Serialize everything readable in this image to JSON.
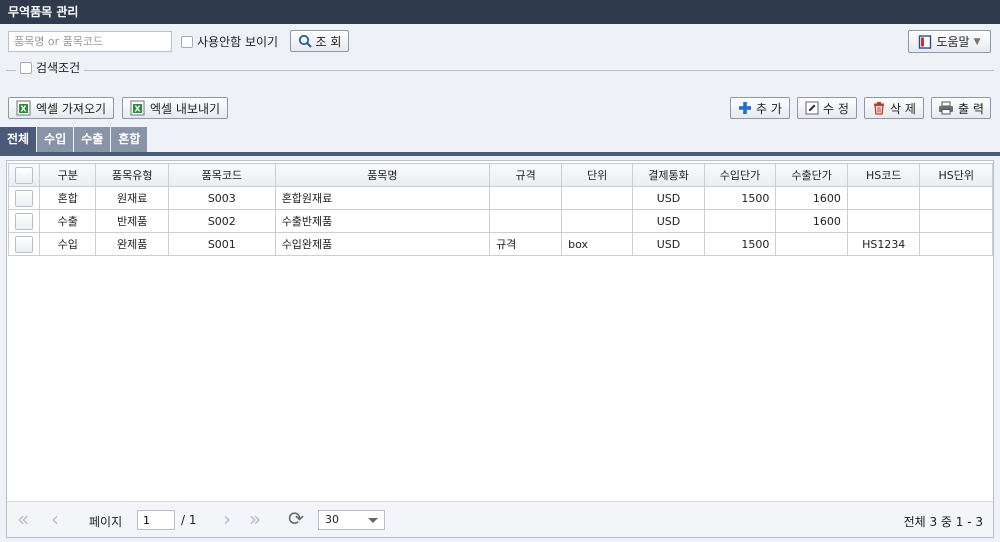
{
  "window": {
    "title": "무역품목 관리"
  },
  "search": {
    "placeholder": "품목명 or 품목코드",
    "value": ""
  },
  "show_unused": {
    "label": "사용안함 보이기",
    "checked": false
  },
  "buttons": {
    "search": "조 회",
    "help": "도움말",
    "excel_import": "엑셀 가져오기",
    "excel_export": "엑셀 내보내기",
    "add": "추 가",
    "edit": "수 정",
    "delete": "삭 제",
    "print": "출 력"
  },
  "search_conditions": {
    "label": "검색조건",
    "checked": false
  },
  "tabs": [
    {
      "label": "전체",
      "active": true
    },
    {
      "label": "수입",
      "active": false
    },
    {
      "label": "수출",
      "active": false
    },
    {
      "label": "혼합",
      "active": false
    }
  ],
  "grid": {
    "columns": [
      "구분",
      "품목유형",
      "품목코드",
      "품목명",
      "규격",
      "단위",
      "결제통화",
      "수입단가",
      "수출단가",
      "HS코드",
      "HS단위"
    ],
    "rows": [
      [
        "혼합",
        "원재료",
        "S003",
        "혼합원재료",
        "",
        "",
        "USD",
        "1500",
        "1600",
        "",
        ""
      ],
      [
        "수출",
        "반제품",
        "S002",
        "수출반제품",
        "",
        "",
        "USD",
        "",
        "1600",
        "",
        ""
      ],
      [
        "수입",
        "완제품",
        "S001",
        "수입완제품",
        "규격",
        "box",
        "USD",
        "1500",
        "",
        "HS1234",
        ""
      ]
    ]
  },
  "pager": {
    "page_label": "페이지",
    "current_page": "1",
    "total_pages": "/ 1",
    "page_size": "30",
    "summary": "전체 3 중 1 - 3"
  },
  "colors": {
    "titlebar": "#2f3a4d",
    "tab_active": "#4a5a78",
    "tab_inactive": "#8994a8",
    "add_icon": "#1f6fd1",
    "excel_icon": "#2e8b3a"
  }
}
